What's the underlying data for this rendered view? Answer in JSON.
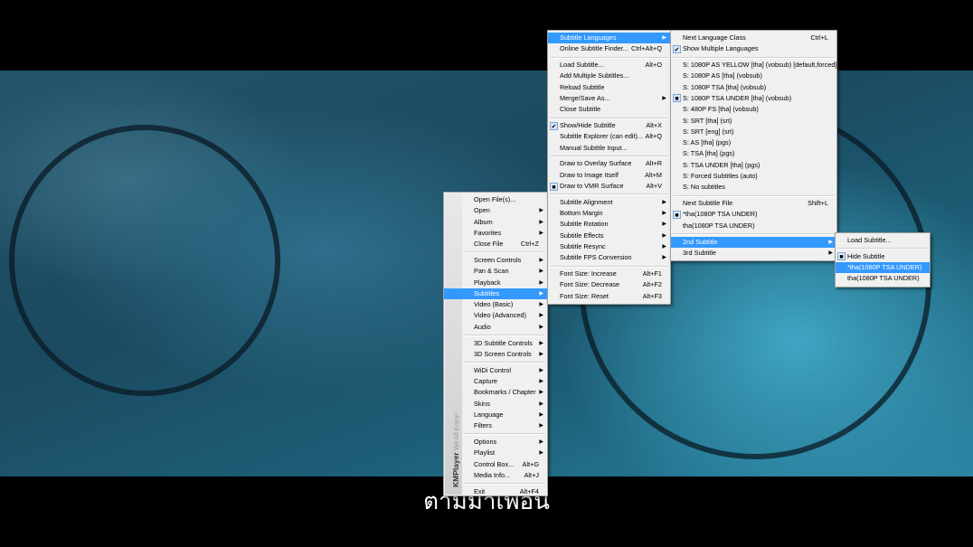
{
  "video": {
    "subtitle": "ตามมาเพื่อน"
  },
  "brand": {
    "name": "KMPlayer",
    "tagline": "We All Enjoy!"
  },
  "menus": {
    "main": [
      {
        "label": "Open File(s)..."
      },
      {
        "label": "Open",
        "submenu": true
      },
      {
        "label": "Album",
        "submenu": true
      },
      {
        "label": "Favorites",
        "submenu": true
      },
      {
        "label": "Close File",
        "shortcut": "Ctrl+Z"
      },
      {
        "sep": true
      },
      {
        "label": "Screen Controls",
        "submenu": true
      },
      {
        "label": "Pan & Scan",
        "submenu": true
      },
      {
        "label": "Playback",
        "submenu": true
      },
      {
        "label": "Subtitles",
        "submenu": true,
        "highlighted": true
      },
      {
        "label": "Video (Basic)",
        "submenu": true
      },
      {
        "label": "Video (Advanced)",
        "submenu": true
      },
      {
        "label": "Audio",
        "submenu": true
      },
      {
        "sep": true
      },
      {
        "label": "3D Subtitle Controls",
        "submenu": true
      },
      {
        "label": "3D Screen Controls",
        "submenu": true
      },
      {
        "sep": true
      },
      {
        "label": "WiDi Control",
        "submenu": true
      },
      {
        "label": "Capture",
        "submenu": true
      },
      {
        "label": "Bookmarks / Chapter",
        "submenu": true
      },
      {
        "label": "Skins",
        "submenu": true
      },
      {
        "label": "Language",
        "submenu": true
      },
      {
        "label": "Filters",
        "submenu": true
      },
      {
        "sep": true
      },
      {
        "label": "Options",
        "submenu": true
      },
      {
        "label": "Playlist",
        "submenu": true
      },
      {
        "label": "Control Box...",
        "shortcut": "Alt+G"
      },
      {
        "label": "Media Info...",
        "shortcut": "Alt+J"
      },
      {
        "sep": true
      },
      {
        "label": "Exit",
        "shortcut": "Alt+F4"
      }
    ],
    "subtitles": [
      {
        "label": "Subtitle Languages",
        "submenu": true,
        "highlighted": true
      },
      {
        "label": "Online Subtitle Finder...",
        "shortcut": "Ctrl+Alt+Q"
      },
      {
        "sep": true
      },
      {
        "label": "Load Subtitle...",
        "shortcut": "Alt+O"
      },
      {
        "label": "Add Multiple Subtitles..."
      },
      {
        "label": "Reload Subtitle"
      },
      {
        "label": "Merge/Save As...",
        "submenu": true
      },
      {
        "label": "Close Subtitle"
      },
      {
        "sep": true
      },
      {
        "label": "Show/Hide Subtitle",
        "shortcut": "Alt+X",
        "mark": "check"
      },
      {
        "label": "Subtitle Explorer (can edit)...",
        "shortcut": "Alt+Q"
      },
      {
        "label": "Manual Subtitle Input..."
      },
      {
        "sep": true
      },
      {
        "label": "Draw to Overlay Surface",
        "shortcut": "Alt+R"
      },
      {
        "label": "Draw to Image Itself",
        "shortcut": "Alt+M"
      },
      {
        "label": "Draw to VMR Surface",
        "shortcut": "Alt+V",
        "mark": "dot"
      },
      {
        "sep": true
      },
      {
        "label": "Subtitle Alignment",
        "submenu": true
      },
      {
        "label": "Bottom Margin",
        "submenu": true
      },
      {
        "label": "Subtitle Rotation",
        "submenu": true
      },
      {
        "label": "Subtitle Effects",
        "submenu": true
      },
      {
        "label": "Subtitle Resync",
        "submenu": true
      },
      {
        "label": "Subtitle FPS Conversion",
        "submenu": true
      },
      {
        "sep": true
      },
      {
        "label": "Font Size: Increase",
        "shortcut": "Alt+F1"
      },
      {
        "label": "Font Size: Decrease",
        "shortcut": "Alt+F2"
      },
      {
        "label": "Font Size: Reset",
        "shortcut": "Alt+F3"
      }
    ],
    "languages": [
      {
        "label": "Next Language Class",
        "shortcut": "Ctrl+L"
      },
      {
        "label": "Show Multiple Languages",
        "mark": "check"
      },
      {
        "sep": true
      },
      {
        "label": "S: 1080P AS YELLOW [tha] (vobsub) [default,forced]"
      },
      {
        "label": "S: 1080P AS [tha] (vobsub)"
      },
      {
        "label": "S: 1080P TSA [tha] (vobsub)"
      },
      {
        "label": "S: 1080P TSA UNDER [tha] (vobsub)",
        "mark": "dot"
      },
      {
        "label": "S: 480P FS [tha] (vobsub)"
      },
      {
        "label": "S: SRT [tha] (srt)"
      },
      {
        "label": "S: SRT [eng] (srt)"
      },
      {
        "label": "S: AS [tha] (pgs)"
      },
      {
        "label": "S: TSA [tha] (pgs)"
      },
      {
        "label": "S: TSA UNDER [tha] (pgs)"
      },
      {
        "label": "S: Forced Subtitles (auto)"
      },
      {
        "label": "S: No subtitles"
      },
      {
        "sep": true
      },
      {
        "label": "Next Subtitle File",
        "shortcut": "Shift+L"
      },
      {
        "label": "*tha(1080P TSA UNDER)",
        "mark": "dot"
      },
      {
        "label": "tha(1080P TSA UNDER)"
      },
      {
        "sep": true
      },
      {
        "label": "2nd Subtitle",
        "submenu": true,
        "highlighted": true
      },
      {
        "label": "3rd Subtitle",
        "submenu": true
      }
    ],
    "second_subtitle": [
      {
        "label": "Load Subtitle..."
      },
      {
        "sep": true
      },
      {
        "label": "Hide Subtitle",
        "mark": "dot"
      },
      {
        "label": "*tha(1080P TSA UNDER)",
        "highlighted": true
      },
      {
        "label": "tha(1080P TSA UNDER)"
      }
    ]
  },
  "icons": {
    "check": "✔",
    "dot": "■",
    "arrow": "▶"
  }
}
